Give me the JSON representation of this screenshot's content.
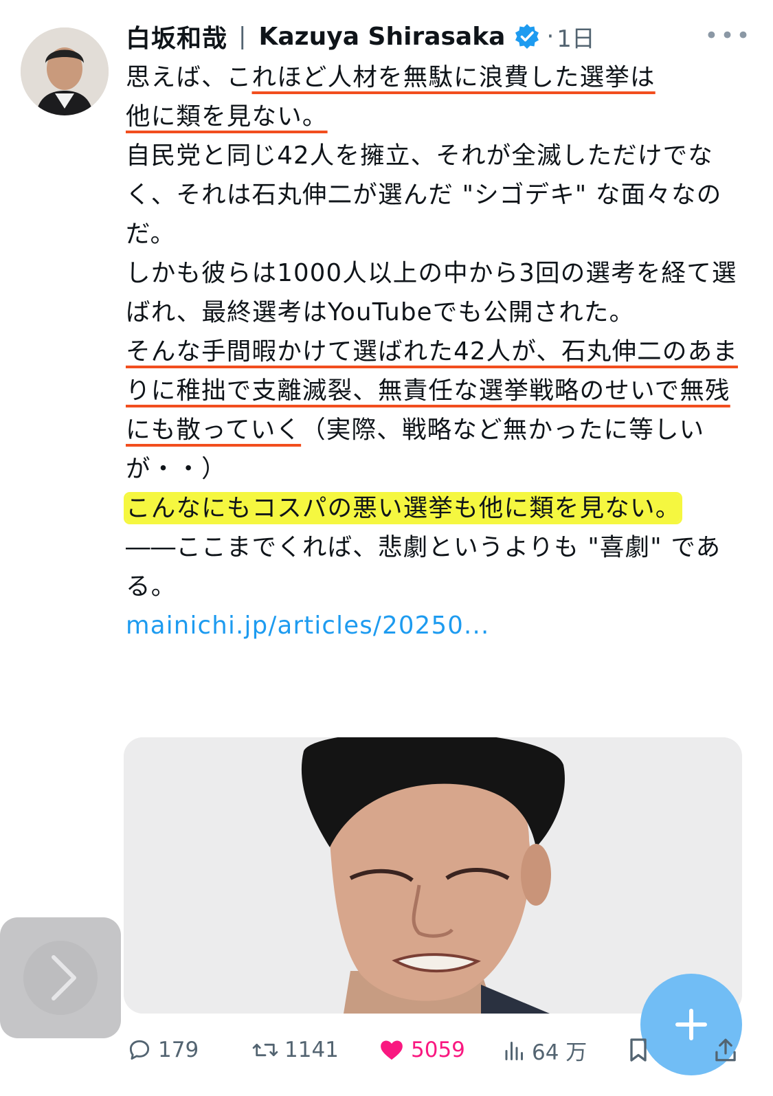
{
  "tweet": {
    "display_name": "白坂和哉",
    "handle_name": "Kazuya Shirasaka",
    "separator": "|",
    "dot": "·",
    "time": "1日",
    "verified": true,
    "more_label": "•••",
    "lines": {
      "l1a": "思えば、こ",
      "l1b": "れほど人材を無駄に浪費した選挙は",
      "l2": "他に類を見ない。",
      "p2": "自民党と同じ42人を擁立、それが全滅しただけでなく、それは石丸伸二が選んだ \"シゴデキ\" な面々なのだ。",
      "p3": "しかも彼らは1000人以上の中から3回の選考を経て選ばれ、最終選考はYouTubeでも公開された。",
      "p4a": "そんな手間暇かけて選ばれた42人が、石丸伸二のあまりに稚拙で支離滅裂、無責任な選挙戦略のせいで無残にも散っていく",
      "p4b": "（実際、戦略など無かったに等しいが・・）",
      "p5": "こんなにもコスパの悪い選挙も他に類を見ない。",
      "p6": "――ここまでくれば、悲劇というよりも \"喜劇\" である。",
      "link": "mainichi.jp/articles/20250..."
    },
    "actions": {
      "replies": "179",
      "retweets": "1141",
      "likes": "5059",
      "views": "64 万"
    }
  },
  "colors": {
    "link": "#1d9bf0",
    "underline": "#f24e1e",
    "highlight": "#f5f740",
    "like": "#f91880",
    "fab": "#71bdf5"
  },
  "icons": {
    "verified": "verified-badge-icon",
    "more": "more-options-icon",
    "reply": "reply-icon",
    "retweet": "retweet-icon",
    "like": "heart-icon",
    "views": "views-chart-icon",
    "bookmark": "bookmark-icon",
    "share": "share-icon",
    "fab": "plus-icon",
    "prev": "chevron-right-icon"
  }
}
